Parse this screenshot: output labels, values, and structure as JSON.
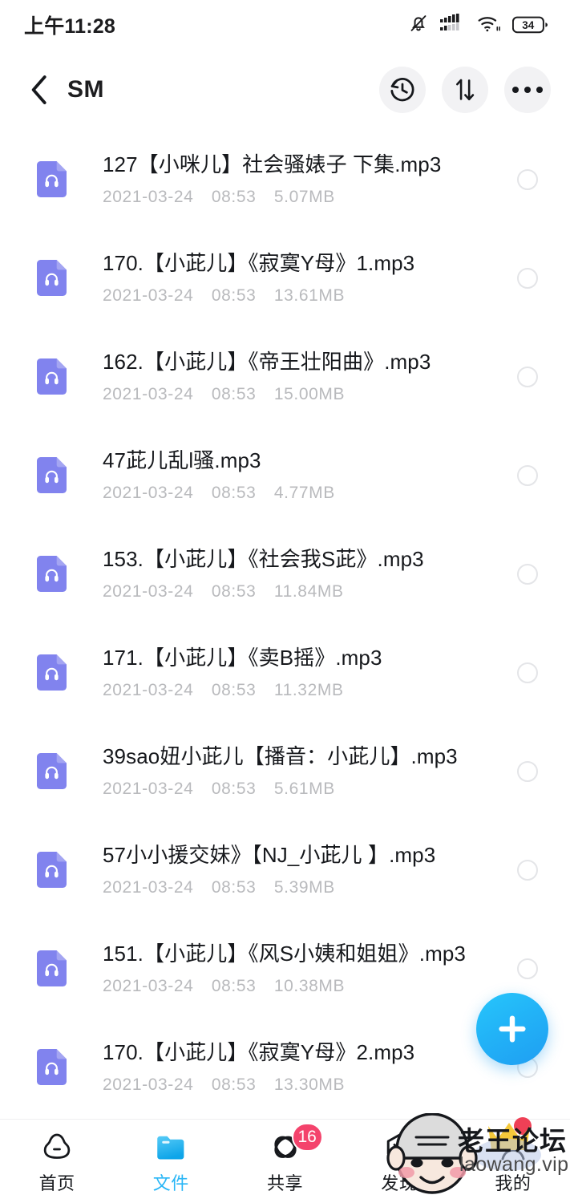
{
  "status_bar": {
    "time": "上午11:28",
    "battery_level": "34",
    "icons": [
      "bell-muted-icon",
      "signal-bars-icon",
      "wifi-icon",
      "battery-icon"
    ]
  },
  "app_bar": {
    "back_icon": "chevron-left-icon",
    "title": "SM",
    "actions": [
      {
        "name": "history-button",
        "icon": "history-clock-icon"
      },
      {
        "name": "sort-button",
        "icon": "sort-updown-arrows-icon"
      },
      {
        "name": "more-button",
        "icon": "more-ellipsis-icon"
      }
    ]
  },
  "colors": {
    "file_icon_purple": "#8183ee",
    "accent_blue": "#29b6f6",
    "badge_pink": "#f4436c",
    "fab_cyan": "#27c6fb",
    "title_text": "#16181c",
    "sub_text": "#b9babd"
  },
  "files": [
    {
      "title": "127【小咪儿】社会骚婊子 下集.mp3",
      "date": "2021-03-24",
      "time": "08:53",
      "size": "5.07MB"
    },
    {
      "title": "170.【小茈儿】《寂寞Y母》1.mp3",
      "date": "2021-03-24",
      "time": "08:53",
      "size": "13.61MB"
    },
    {
      "title": "162.【小茈儿】《帝王壮阳曲》.mp3",
      "date": "2021-03-24",
      "time": "08:53",
      "size": "15.00MB"
    },
    {
      "title": "47茈儿乱l骚.mp3",
      "date": "2021-03-24",
      "time": "08:53",
      "size": "4.77MB"
    },
    {
      "title": "153.【小茈儿】《社会我S茈》.mp3",
      "date": "2021-03-24",
      "time": "08:53",
      "size": "11.84MB"
    },
    {
      "title": "171.【小茈儿】《卖B摇》.mp3",
      "date": "2021-03-24",
      "time": "08:53",
      "size": "11.32MB"
    },
    {
      "title": "39sao妞小茈儿【播音：小茈儿】.mp3",
      "date": "2021-03-24",
      "time": "08:53",
      "size": "5.61MB"
    },
    {
      "title": "57小小援交妹》【NJ_小茈儿 】.mp3",
      "date": "2021-03-24",
      "time": "08:53",
      "size": "5.39MB"
    },
    {
      "title": "151.【小茈儿】《风S小姨和姐姐》.mp3",
      "date": "2021-03-24",
      "time": "08:53",
      "size": "10.38MB"
    },
    {
      "title": "170.【小茈儿】《寂寞Y母》2.mp3",
      "date": "2021-03-24",
      "time": "08:53",
      "size": "13.30MB"
    }
  ],
  "fab": {
    "icon": "plus-icon",
    "label": "+"
  },
  "bottom_nav": {
    "items": [
      {
        "label": "首页",
        "icon": "home-cloud-icon",
        "active": false,
        "badge": ""
      },
      {
        "label": "文件",
        "icon": "folder-icon",
        "active": true,
        "badge": ""
      },
      {
        "label": "共享",
        "icon": "share-atom-icon",
        "active": false,
        "badge": "16"
      },
      {
        "label": "发现",
        "icon": "discover-hexagon-icon",
        "active": false,
        "badge": ""
      },
      {
        "label": "我的",
        "icon": "profile-icon",
        "active": false,
        "badge": ""
      }
    ]
  },
  "watermark": {
    "title": "老王论坛",
    "url": "laowang.vip",
    "logo": "old-man-face-logo"
  }
}
